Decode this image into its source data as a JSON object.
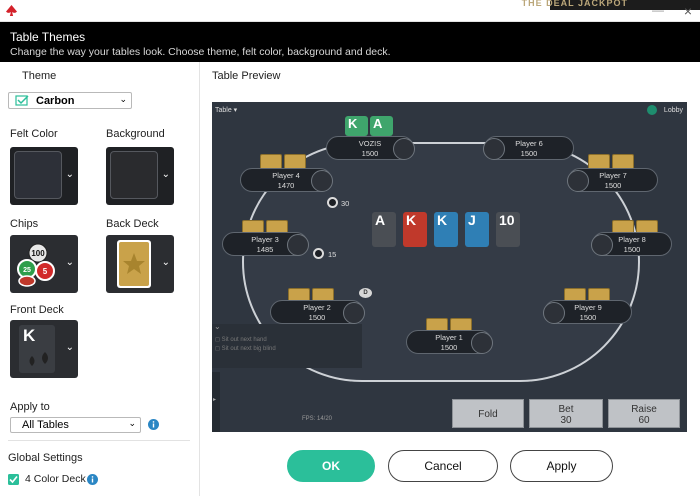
{
  "window": {
    "banner_text": "THE DEAL JACKPOT",
    "title": "Table Themes",
    "subtitle": "Change the way your tables look. Choose theme, felt color, background and deck."
  },
  "left": {
    "theme_label": "Theme",
    "theme_value": "Carbon",
    "felt_label": "Felt Color",
    "felt_color": "#2d3038",
    "background_label": "Background",
    "background_color": "#2a2b2e",
    "chips_label": "Chips",
    "chip_values": [
      "100",
      "25",
      "5"
    ],
    "back_deck_label": "Back Deck",
    "front_deck_label": "Front Deck",
    "front_deck_letter": "K",
    "apply_to_label": "Apply to",
    "apply_to_value": "All Tables",
    "global_settings_label": "Global Settings",
    "four_color_deck_label": "4 Color Deck",
    "four_color_deck_checked": true
  },
  "preview": {
    "title": "Table Preview",
    "table_menu": "Table",
    "lobby": "Lobby",
    "fps": "FPS: 14/20",
    "sit_out_next_hand": "Sit out next hand",
    "sit_out_big_blind": "Sit out next big blind",
    "hero_cards": [
      "K",
      "A"
    ],
    "board_cards": [
      {
        "rank": "A",
        "color": "#4a4e54"
      },
      {
        "rank": "K",
        "color": "#c0392b"
      },
      {
        "rank": "K",
        "color": "#2f7fb5"
      },
      {
        "rank": "J",
        "color": "#2f7fb5"
      },
      {
        "rank": "10",
        "color": "#4a4e54"
      }
    ],
    "bets": [
      "30",
      "15"
    ],
    "dealer": "D",
    "players": [
      {
        "name": "VOZIS",
        "stack": "1500"
      },
      {
        "name": "Player 6",
        "stack": "1500"
      },
      {
        "name": "Player 4",
        "stack": "1470"
      },
      {
        "name": "Player 7",
        "stack": "1500"
      },
      {
        "name": "Player 3",
        "stack": "1485"
      },
      {
        "name": "Player 8",
        "stack": "1500"
      },
      {
        "name": "Player 2",
        "stack": "1500"
      },
      {
        "name": "Player 9",
        "stack": "1500"
      },
      {
        "name": "Player 1",
        "stack": "1500"
      }
    ],
    "actions": {
      "fold": "Fold",
      "bet": "Bet",
      "bet_amount": "30",
      "raise": "Raise",
      "raise_amount": "60"
    }
  },
  "buttons": {
    "ok": "OK",
    "cancel": "Cancel",
    "apply": "Apply"
  },
  "colors": {
    "accent": "#2bbf9a",
    "preview_bg": "#2f3640"
  }
}
